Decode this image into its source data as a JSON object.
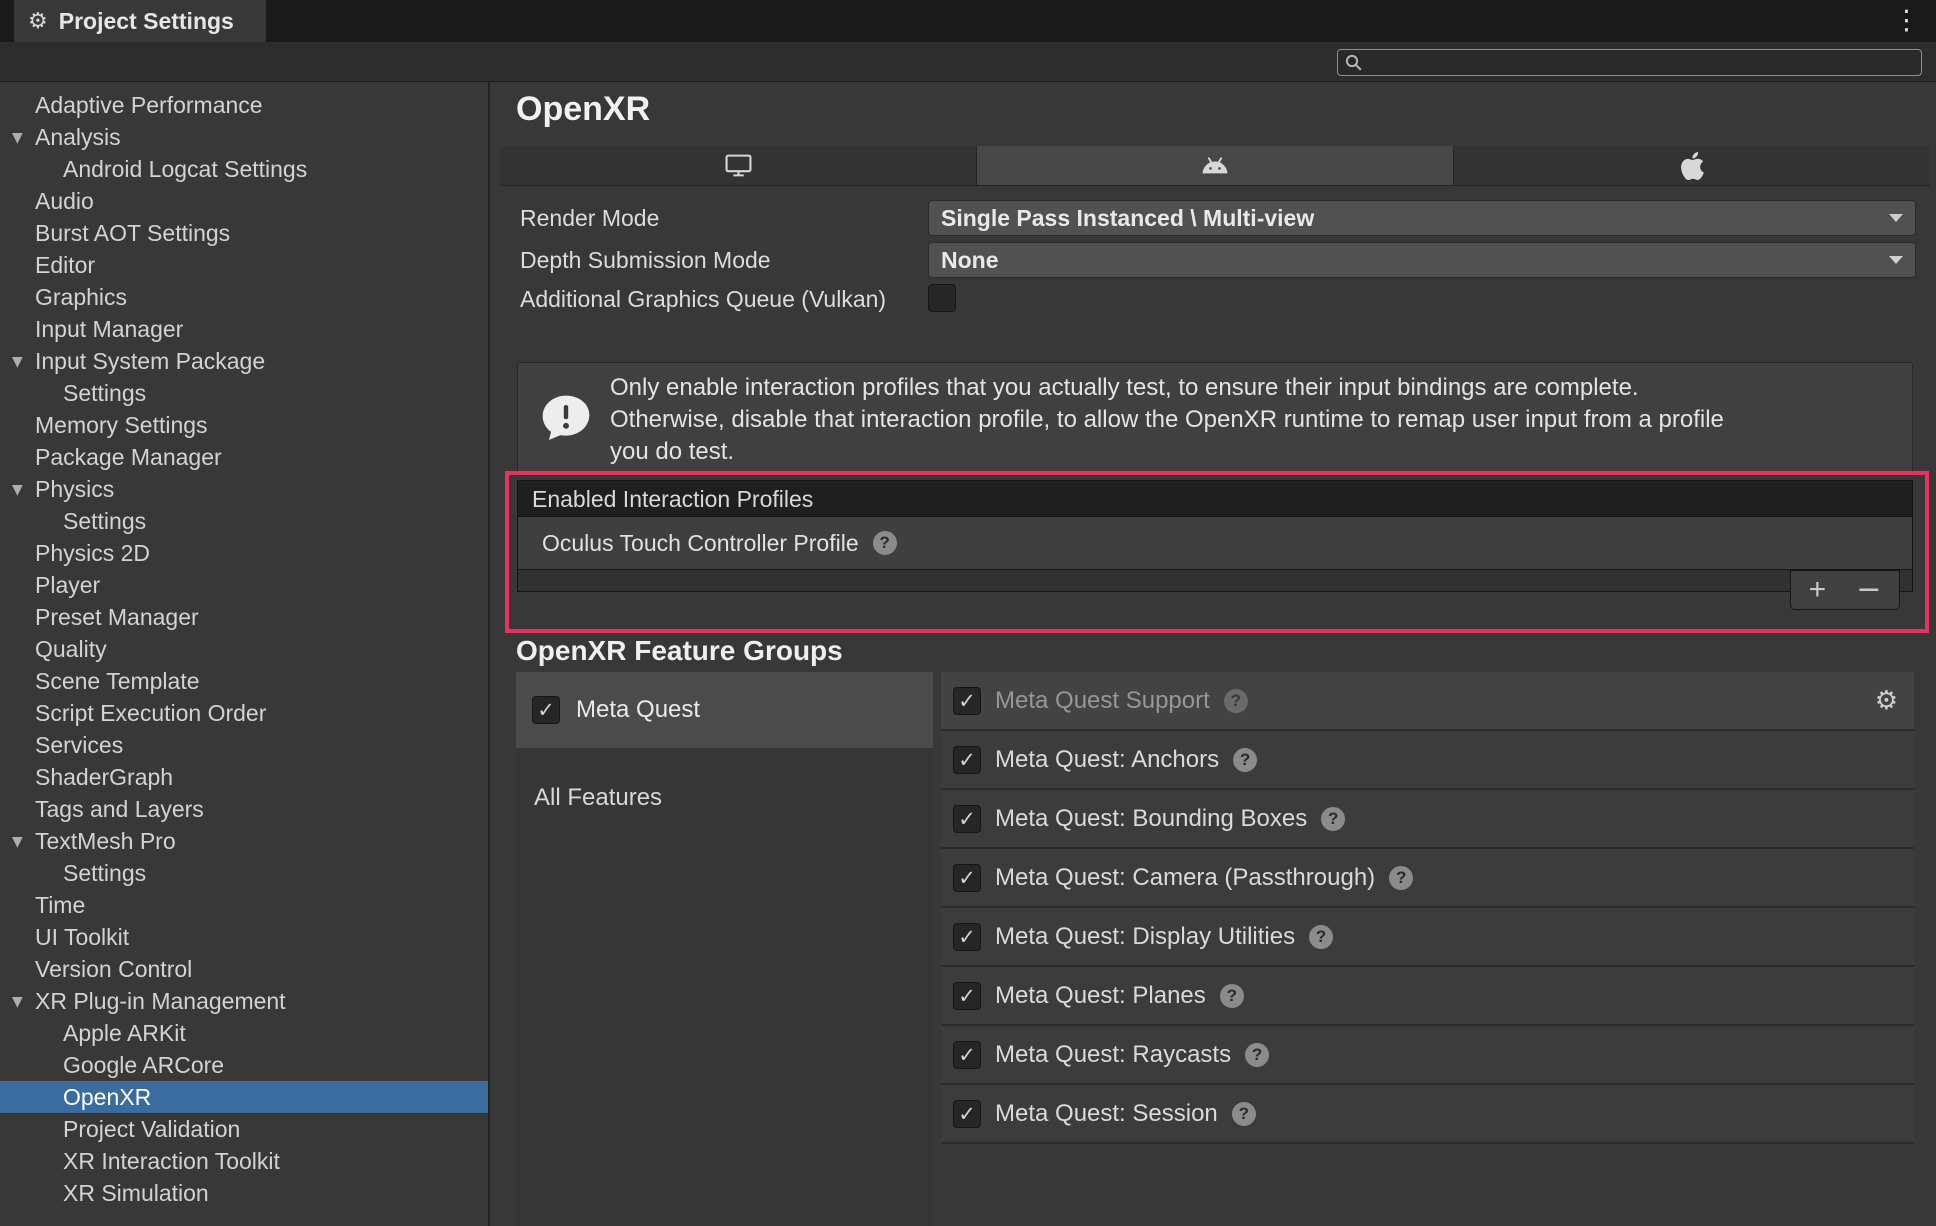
{
  "window": {
    "tab_title": "Project Settings"
  },
  "icons": {
    "gear": "⚙",
    "kebab": "⋮",
    "foldout": "▼",
    "check": "✓"
  },
  "search": {
    "value": "",
    "placeholder": ""
  },
  "sidebar": {
    "items": [
      {
        "label": "Adaptive Performance",
        "indent": 0,
        "foldout": false,
        "selected": false
      },
      {
        "label": "Analysis",
        "indent": 0,
        "foldout": true,
        "selected": false
      },
      {
        "label": "Android Logcat Settings",
        "indent": 1,
        "foldout": false,
        "selected": false
      },
      {
        "label": "Audio",
        "indent": 0,
        "foldout": false,
        "selected": false
      },
      {
        "label": "Burst AOT Settings",
        "indent": 0,
        "foldout": false,
        "selected": false
      },
      {
        "label": "Editor",
        "indent": 0,
        "foldout": false,
        "selected": false
      },
      {
        "label": "Graphics",
        "indent": 0,
        "foldout": false,
        "selected": false
      },
      {
        "label": "Input Manager",
        "indent": 0,
        "foldout": false,
        "selected": false
      },
      {
        "label": "Input System Package",
        "indent": 0,
        "foldout": true,
        "selected": false
      },
      {
        "label": "Settings",
        "indent": 1,
        "foldout": false,
        "selected": false
      },
      {
        "label": "Memory Settings",
        "indent": 0,
        "foldout": false,
        "selected": false
      },
      {
        "label": "Package Manager",
        "indent": 0,
        "foldout": false,
        "selected": false
      },
      {
        "label": "Physics",
        "indent": 0,
        "foldout": true,
        "selected": false
      },
      {
        "label": "Settings",
        "indent": 1,
        "foldout": false,
        "selected": false
      },
      {
        "label": "Physics 2D",
        "indent": 0,
        "foldout": false,
        "selected": false
      },
      {
        "label": "Player",
        "indent": 0,
        "foldout": false,
        "selected": false
      },
      {
        "label": "Preset Manager",
        "indent": 0,
        "foldout": false,
        "selected": false
      },
      {
        "label": "Quality",
        "indent": 0,
        "foldout": false,
        "selected": false
      },
      {
        "label": "Scene Template",
        "indent": 0,
        "foldout": false,
        "selected": false
      },
      {
        "label": "Script Execution Order",
        "indent": 0,
        "foldout": false,
        "selected": false
      },
      {
        "label": "Services",
        "indent": 0,
        "foldout": false,
        "selected": false
      },
      {
        "label": "ShaderGraph",
        "indent": 0,
        "foldout": false,
        "selected": false
      },
      {
        "label": "Tags and Layers",
        "indent": 0,
        "foldout": false,
        "selected": false
      },
      {
        "label": "TextMesh Pro",
        "indent": 0,
        "foldout": true,
        "selected": false
      },
      {
        "label": "Settings",
        "indent": 1,
        "foldout": false,
        "selected": false
      },
      {
        "label": "Time",
        "indent": 0,
        "foldout": false,
        "selected": false
      },
      {
        "label": "UI Toolkit",
        "indent": 0,
        "foldout": false,
        "selected": false
      },
      {
        "label": "Version Control",
        "indent": 0,
        "foldout": false,
        "selected": false
      },
      {
        "label": "XR Plug-in Management",
        "indent": 0,
        "foldout": true,
        "selected": false
      },
      {
        "label": "Apple ARKit",
        "indent": 1,
        "foldout": false,
        "selected": false
      },
      {
        "label": "Google ARCore",
        "indent": 1,
        "foldout": false,
        "selected": false
      },
      {
        "label": "OpenXR",
        "indent": 1,
        "foldout": false,
        "selected": true
      },
      {
        "label": "Project Validation",
        "indent": 1,
        "foldout": false,
        "selected": false
      },
      {
        "label": "XR Interaction Toolkit",
        "indent": 1,
        "foldout": false,
        "selected": false
      },
      {
        "label": "XR Simulation",
        "indent": 1,
        "foldout": false,
        "selected": false
      }
    ]
  },
  "main": {
    "title": "OpenXR",
    "platform_tabs": [
      {
        "id": "standalone",
        "icon": "monitor",
        "selected": false
      },
      {
        "id": "android",
        "icon": "android",
        "selected": true
      },
      {
        "id": "ios",
        "icon": "apple",
        "selected": false
      }
    ],
    "fields": {
      "render_mode": {
        "label": "Render Mode",
        "value": "Single Pass Instanced \\ Multi-view"
      },
      "depth_submission": {
        "label": "Depth Submission Mode",
        "value": "None"
      },
      "graphics_queue": {
        "label": "Additional Graphics Queue (Vulkan)",
        "checked": false
      }
    },
    "help_box": {
      "lines": [
        "Only enable interaction profiles that you actually test, to ensure their input bindings are complete.",
        "Otherwise, disable that interaction profile, to allow the OpenXR runtime to remap user input from a profile",
        "you do test."
      ]
    },
    "interaction_profiles": {
      "header": "Enabled Interaction Profiles",
      "rows": [
        "Oculus Touch Controller Profile"
      ],
      "add_label": "+",
      "remove_label": "−"
    },
    "feature_groups": {
      "heading": "OpenXR Feature Groups",
      "groups": [
        {
          "label": "Meta Quest",
          "checked": true,
          "selected": true
        }
      ],
      "all_features_label": "All Features",
      "features": [
        {
          "label": "Meta Quest Support",
          "checked": true,
          "disabled": true,
          "gear": true
        },
        {
          "label": "Meta Quest: Anchors",
          "checked": true,
          "disabled": false,
          "gear": false
        },
        {
          "label": "Meta Quest: Bounding Boxes",
          "checked": true,
          "disabled": false,
          "gear": false
        },
        {
          "label": "Meta Quest: Camera (Passthrough)",
          "checked": true,
          "disabled": false,
          "gear": false
        },
        {
          "label": "Meta Quest: Display Utilities",
          "checked": true,
          "disabled": false,
          "gear": false
        },
        {
          "label": "Meta Quest: Planes",
          "checked": true,
          "disabled": false,
          "gear": false
        },
        {
          "label": "Meta Quest: Raycasts",
          "checked": true,
          "disabled": false,
          "gear": false
        },
        {
          "label": "Meta Quest: Session",
          "checked": true,
          "disabled": false,
          "gear": false
        }
      ]
    },
    "annotation_color": "#e8325f"
  }
}
